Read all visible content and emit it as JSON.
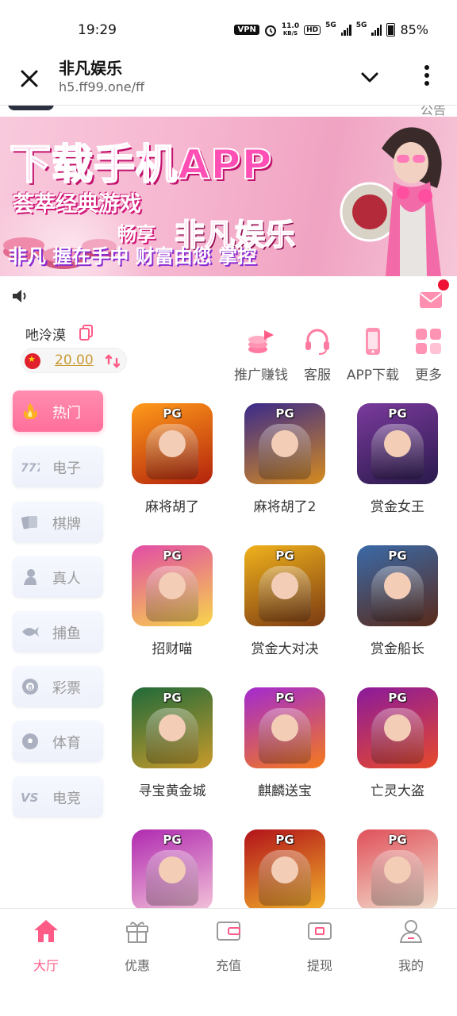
{
  "status_bar": {
    "time": "19:29",
    "vpn": "VPN",
    "net_speed_value": "11.0",
    "net_speed_unit": "KB/S",
    "hd": "HD",
    "sim1": "5G",
    "sim2": "5G",
    "battery": "85%"
  },
  "browser": {
    "title": "非凡娱乐",
    "url": "h5.ff99.one/ff"
  },
  "sliver_text": "公告",
  "banner": {
    "headline": "下载手机APP",
    "line2": "荟萃经典游戏",
    "line3a": "畅享",
    "line3b": "非凡娱乐",
    "line4": "非凡 握在手中 财富由您 掌控"
  },
  "user": {
    "name": "吔泠漠",
    "balance": "20.00"
  },
  "quick_actions": [
    {
      "label": "推广赚钱",
      "icon": "coins-stack-icon"
    },
    {
      "label": "客服",
      "icon": "headset-icon"
    },
    {
      "label": "APP下载",
      "icon": "phone-icon"
    },
    {
      "label": "更多",
      "icon": "grid-more-icon"
    }
  ],
  "categories": [
    {
      "label": "热门",
      "icon": "fire-icon",
      "active": true
    },
    {
      "label": "电子",
      "icon": "slot-777-icon",
      "active": false
    },
    {
      "label": "棋牌",
      "icon": "cards-icon",
      "active": false
    },
    {
      "label": "真人",
      "icon": "dealer-icon",
      "active": false
    },
    {
      "label": "捕鱼",
      "icon": "fish-icon",
      "active": false
    },
    {
      "label": "彩票",
      "icon": "lottery-ball-icon",
      "active": false
    },
    {
      "label": "体育",
      "icon": "soccer-ball-icon",
      "active": false
    },
    {
      "label": "电竞",
      "icon": "vs-icon",
      "active": false
    }
  ],
  "game_provider_badge": "PG",
  "games": [
    {
      "name": "麻将胡了",
      "colors": [
        "#ff9a1a",
        "#b3220c"
      ]
    },
    {
      "name": "麻将胡了2",
      "colors": [
        "#3a2a8c",
        "#d68b1e"
      ]
    },
    {
      "name": "赏金女王",
      "colors": [
        "#7a3a9c",
        "#2a1a4c"
      ]
    },
    {
      "name": "招财喵",
      "colors": [
        "#e24ca6",
        "#f7d54a"
      ]
    },
    {
      "name": "赏金大对决",
      "colors": [
        "#f0b21c",
        "#7b3a12"
      ]
    },
    {
      "name": "赏金船长",
      "colors": [
        "#3a6aa8",
        "#5a2a1a"
      ]
    },
    {
      "name": "寻宝黄金城",
      "colors": [
        "#1f6a3a",
        "#c89a2a"
      ]
    },
    {
      "name": "麒麟送宝",
      "colors": [
        "#a22ad0",
        "#f57a1c"
      ]
    },
    {
      "name": "亡灵大盗",
      "colors": [
        "#8a1a9c",
        "#e84a2a"
      ]
    },
    {
      "name": "",
      "colors": [
        "#b02ab0",
        "#f3c2d8"
      ]
    },
    {
      "name": "",
      "colors": [
        "#b2121a",
        "#f2b22a"
      ]
    },
    {
      "name": "",
      "colors": [
        "#e0505a",
        "#f3e2d0"
      ]
    }
  ],
  "tabs": [
    {
      "label": "大厅",
      "icon": "home-icon",
      "active": true
    },
    {
      "label": "优惠",
      "icon": "gift-icon",
      "active": false
    },
    {
      "label": "充值",
      "icon": "wallet-icon",
      "active": false
    },
    {
      "label": "提现",
      "icon": "withdraw-icon",
      "active": false
    },
    {
      "label": "我的",
      "icon": "user-icon",
      "active": false
    }
  ],
  "colors": {
    "accent": "#ff5b87",
    "balance_gold": "#c99a32"
  }
}
